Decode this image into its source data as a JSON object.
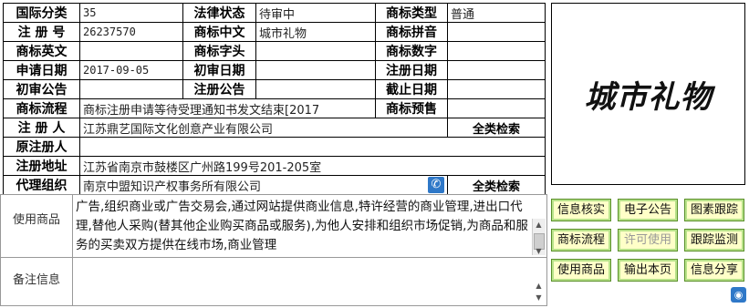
{
  "info": {
    "row1": {
      "l1": "国际分类",
      "v1": "35",
      "l2": "法律状态",
      "v2": "待审中",
      "l3": "商标类型",
      "v3": "普通"
    },
    "row2": {
      "l1": "注 册 号",
      "v1": "26237570",
      "l2": "商标中文",
      "v2": "城市礼物",
      "l3": "商标拼音",
      "v3": ""
    },
    "row3": {
      "l1": "商标英文",
      "v1": "",
      "l2": "商标字头",
      "v2": "",
      "l3": "商标数字",
      "v3": ""
    },
    "row4": {
      "l1": "申请日期",
      "v1": "2017-09-05",
      "l2": "初审日期",
      "v2": "",
      "l3": "注册日期",
      "v3": ""
    },
    "row5": {
      "l1": "初审公告",
      "v1": "",
      "l2": "注册公告",
      "v2": "",
      "l3": "截止日期",
      "v3": ""
    },
    "row6": {
      "l1": "商标流程",
      "v1": "商标注册申请等待受理通知书发文结束[2017",
      "l3": "商标预售",
      "v3": ""
    },
    "row7": {
      "l1": "注 册 人",
      "v1": "江苏鼎艺国际文化创意产业有限公司",
      "link": "全类检索"
    },
    "row8": {
      "l1": "原注册人",
      "v1": ""
    },
    "row9": {
      "l1": "注册地址",
      "v1": "江苏省南京市鼓楼区广州路199号201-205室"
    },
    "row10": {
      "l1": "代理组织",
      "v1": "南京中盟知识产权事务所有限公司",
      "link": "全类检索"
    }
  },
  "logo": {
    "text": "城市礼物"
  },
  "goods": {
    "label": "使用商品",
    "text": "广告,组织商业或广告交易会,通过网站提供商业信息,特许经营的商业管理,进出口代理,替他人采购(替其他企业购买商品或服务),为他人安排和组织市场促销,为商品和服务的买卖双方提供在线市场,商业管理"
  },
  "remarks": {
    "label": "备注信息",
    "text": ""
  },
  "buttons": {
    "b1": "信息核实",
    "b2": "电子公告",
    "b3": "图素跟踪",
    "b4": "商标流程",
    "b5": "许可使用",
    "b6": "跟踪监测",
    "b7": "使用商品",
    "b8": "输出本页",
    "b9": "信息分享"
  }
}
